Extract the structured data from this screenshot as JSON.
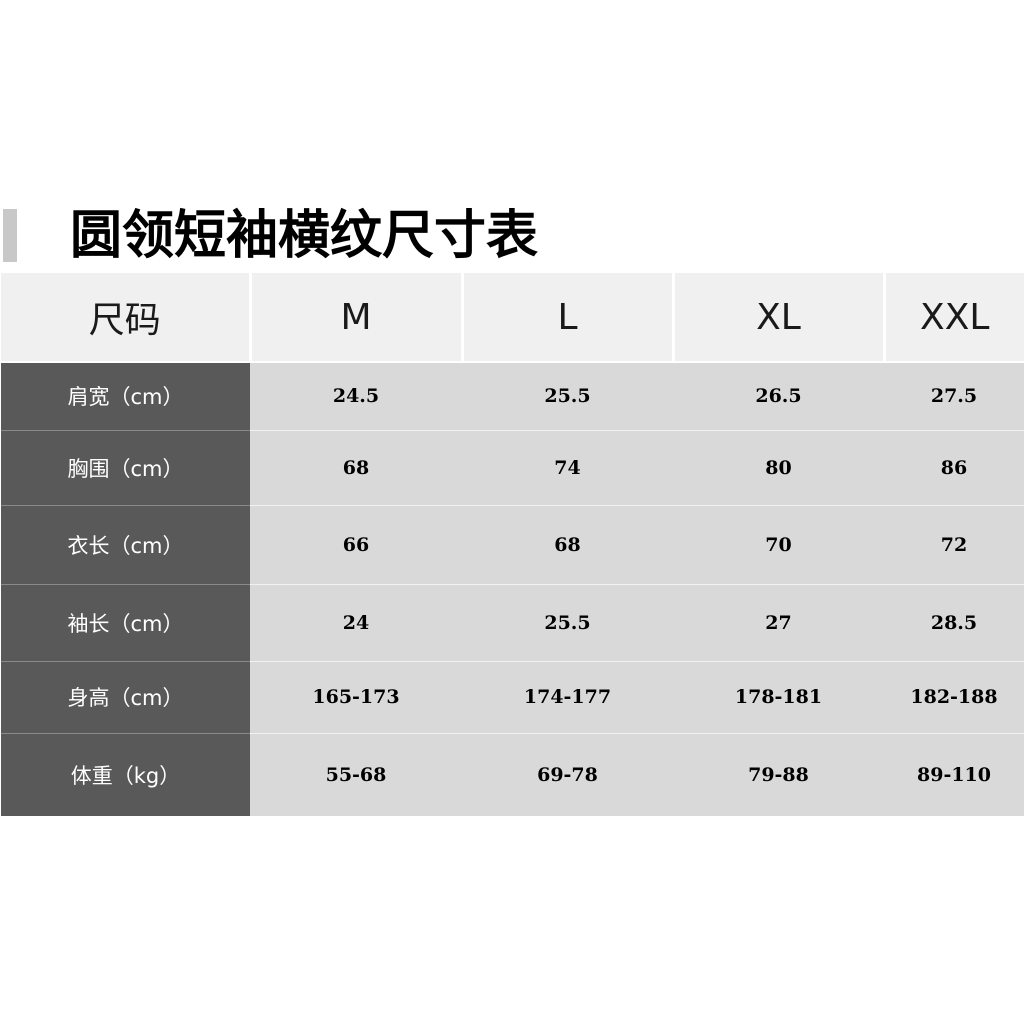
{
  "title": "圆领短袖横纹尺寸表",
  "table": {
    "corner": "尺码",
    "sizes": [
      "M",
      "L",
      "XL",
      "XXL"
    ],
    "rows": [
      {
        "label": "肩宽（cm）",
        "values": [
          "24.5",
          "25.5",
          "26.5",
          "27.5"
        ]
      },
      {
        "label": "胸围（cm）",
        "values": [
          "68",
          "74",
          "80",
          "86"
        ]
      },
      {
        "label": "衣长（cm）",
        "values": [
          "66",
          "68",
          "70",
          "72"
        ]
      },
      {
        "label": "袖长（cm）",
        "values": [
          "24",
          "25.5",
          "27",
          "28.5"
        ]
      },
      {
        "label": "身高（cm）",
        "values": [
          "165-173",
          "174-177",
          "178-181",
          "182-188"
        ]
      },
      {
        "label": "体重（kg）",
        "values": [
          "55-68",
          "69-78",
          "79-88",
          "89-110"
        ]
      }
    ]
  },
  "colors": {
    "header_bg": "#f0f0f0",
    "label_bg": "#595959",
    "value_bg": "#d9d9d9",
    "accent_bar": "#c8c8c8"
  }
}
